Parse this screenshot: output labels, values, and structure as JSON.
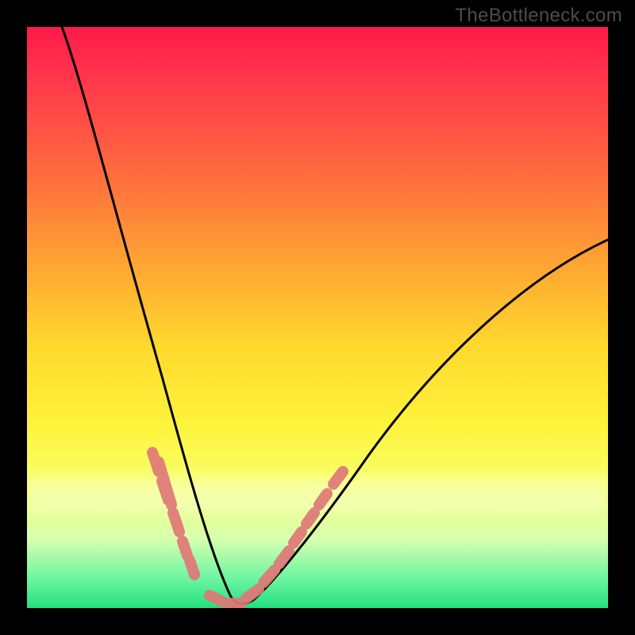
{
  "attribution": "TheBottleneck.com",
  "colors": {
    "frame": "#000000",
    "gradient_top": "#ff1a4a",
    "gradient_bottom": "#23e07e",
    "curve": "#000000",
    "highlight": "#e38383"
  },
  "chart_data": {
    "type": "line",
    "title": "",
    "xlabel": "",
    "ylabel": "",
    "xlim": [
      0,
      100
    ],
    "ylim": [
      0,
      100
    ],
    "series": [
      {
        "name": "bottleneck-curve",
        "x": [
          6,
          10,
          14,
          18,
          22,
          26,
          28,
          30,
          32,
          34,
          36,
          38,
          40,
          44,
          48,
          54,
          60,
          66,
          72,
          78,
          84,
          90,
          96,
          100
        ],
        "y": [
          100,
          88,
          76,
          64,
          52,
          38,
          30,
          22,
          12,
          4,
          0,
          0,
          2,
          6,
          12,
          20,
          27,
          33,
          39,
          45,
          50,
          55,
          60,
          63
        ]
      }
    ],
    "highlight_segments": [
      {
        "x_range": [
          21,
          27
        ],
        "note": "left descending band"
      },
      {
        "x_range": [
          31,
          47
        ],
        "note": "valley and right ascending band"
      }
    ]
  }
}
